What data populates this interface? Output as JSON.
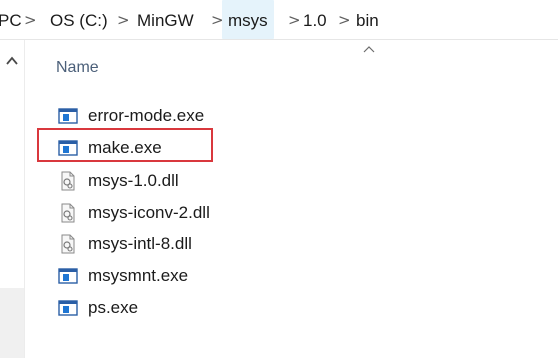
{
  "breadcrumb": {
    "items": [
      {
        "label": "PC"
      },
      {
        "label": "OS (C:)"
      },
      {
        "label": "MinGW"
      },
      {
        "label": "msys"
      },
      {
        "label": "1.0"
      },
      {
        "label": "bin"
      }
    ],
    "separator": ">"
  },
  "file_list": {
    "column_header": "Name",
    "files": [
      {
        "name": "error-mode.exe",
        "icon": "exe-icon"
      },
      {
        "name": "make.exe",
        "icon": "exe-icon",
        "highlighted": true
      },
      {
        "name": "msys-1.0.dll",
        "icon": "dll-icon"
      },
      {
        "name": "msys-iconv-2.dll",
        "icon": "dll-icon"
      },
      {
        "name": "msys-intl-8.dll",
        "icon": "dll-icon"
      },
      {
        "name": "msysmnt.exe",
        "icon": "exe-icon"
      },
      {
        "name": "ps.exe",
        "icon": "exe-icon"
      }
    ]
  },
  "colors": {
    "highlight_border": "#d9383d",
    "header_text": "#4c607a",
    "active_crumb_bg": "#e5f3fb"
  }
}
